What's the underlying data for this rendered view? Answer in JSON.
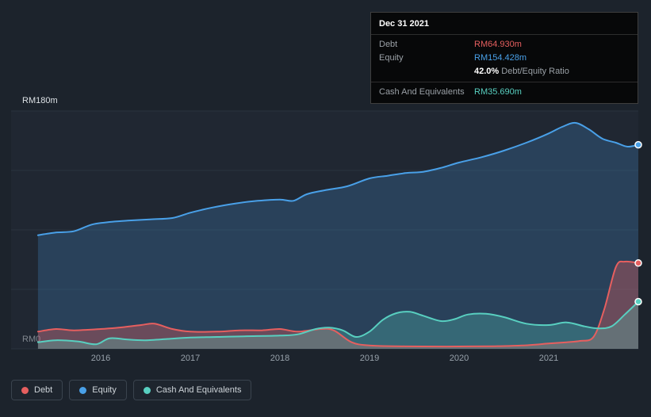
{
  "tooltip": {
    "date": "Dec 31 2021",
    "debt_label": "Debt",
    "debt_value": "RM64.930m",
    "equity_label": "Equity",
    "equity_value": "RM154.428m",
    "ratio_value": "42.0%",
    "ratio_label": "Debt/Equity Ratio",
    "cash_label": "Cash And Equivalents",
    "cash_value": "RM35.690m"
  },
  "axis": {
    "y_top": "RM180m",
    "y_bottom": "RM0",
    "x_ticks": [
      "2016",
      "2017",
      "2018",
      "2019",
      "2020",
      "2021"
    ]
  },
  "legend": {
    "items": [
      {
        "label": "Debt",
        "color": "#e65f5f"
      },
      {
        "label": "Equity",
        "color": "#49a0e8"
      },
      {
        "label": "Cash And Equivalents",
        "color": "#58cfc0"
      }
    ]
  },
  "chart_data": {
    "type": "area",
    "xlim": [
      2015.0,
      2022.0
    ],
    "ylim": [
      0,
      180
    ],
    "y_unit": "RM millions",
    "gridline_values": [
      0,
      45,
      90,
      135,
      180
    ],
    "legend_position": "bottom-left",
    "series": [
      {
        "name": "Equity",
        "color": "#49a0e8",
        "fill_opacity": 0.22,
        "points": [
          [
            2015.3,
            86
          ],
          [
            2015.5,
            88
          ],
          [
            2015.7,
            89
          ],
          [
            2015.9,
            94
          ],
          [
            2016.1,
            96
          ],
          [
            2016.3,
            97
          ],
          [
            2016.55,
            98
          ],
          [
            2016.8,
            99
          ],
          [
            2017,
            103
          ],
          [
            2017.25,
            107
          ],
          [
            2017.5,
            110
          ],
          [
            2017.75,
            112
          ],
          [
            2018,
            113
          ],
          [
            2018.15,
            112
          ],
          [
            2018.3,
            117
          ],
          [
            2018.5,
            120
          ],
          [
            2018.75,
            123
          ],
          [
            2019,
            129
          ],
          [
            2019.2,
            131
          ],
          [
            2019.4,
            133
          ],
          [
            2019.6,
            134
          ],
          [
            2019.8,
            137
          ],
          [
            2020,
            141
          ],
          [
            2020.25,
            145
          ],
          [
            2020.5,
            150
          ],
          [
            2020.75,
            156
          ],
          [
            2021,
            163
          ],
          [
            2021.15,
            168
          ],
          [
            2021.3,
            171
          ],
          [
            2021.45,
            166
          ],
          [
            2021.6,
            159
          ],
          [
            2021.75,
            156
          ],
          [
            2021.88,
            153
          ],
          [
            2022,
            154.428
          ]
        ]
      },
      {
        "name": "Debt",
        "color": "#e65f5f",
        "fill_opacity": 0.35,
        "points": [
          [
            2015.3,
            13
          ],
          [
            2015.5,
            15
          ],
          [
            2015.7,
            14
          ],
          [
            2016,
            15
          ],
          [
            2016.2,
            16
          ],
          [
            2016.45,
            18
          ],
          [
            2016.6,
            19
          ],
          [
            2016.8,
            15
          ],
          [
            2017,
            13
          ],
          [
            2017.3,
            13
          ],
          [
            2017.55,
            14
          ],
          [
            2017.8,
            14
          ],
          [
            2018,
            15
          ],
          [
            2018.2,
            13
          ],
          [
            2018.45,
            15
          ],
          [
            2018.6,
            14
          ],
          [
            2018.8,
            5
          ],
          [
            2019,
            2.5
          ],
          [
            2019.3,
            2
          ],
          [
            2019.6,
            1.8
          ],
          [
            2020,
            1.8
          ],
          [
            2020.4,
            2
          ],
          [
            2020.7,
            2.5
          ],
          [
            2021,
            4
          ],
          [
            2021.2,
            5
          ],
          [
            2021.35,
            6
          ],
          [
            2021.5,
            9
          ],
          [
            2021.62,
            30
          ],
          [
            2021.75,
            62
          ],
          [
            2021.85,
            66
          ],
          [
            2022,
            64.93
          ]
        ]
      },
      {
        "name": "Cash And Equivalents",
        "color": "#58cfc0",
        "fill_opacity": 0.28,
        "points": [
          [
            2015.3,
            5
          ],
          [
            2015.5,
            6.5
          ],
          [
            2015.75,
            5.5
          ],
          [
            2015.95,
            3.5
          ],
          [
            2016.1,
            8
          ],
          [
            2016.3,
            7
          ],
          [
            2016.5,
            6.5
          ],
          [
            2016.75,
            7.5
          ],
          [
            2017,
            8.5
          ],
          [
            2017.3,
            9
          ],
          [
            2017.6,
            9.5
          ],
          [
            2018,
            10
          ],
          [
            2018.2,
            11
          ],
          [
            2018.4,
            15
          ],
          [
            2018.55,
            16
          ],
          [
            2018.7,
            14
          ],
          [
            2018.85,
            9
          ],
          [
            2019,
            13
          ],
          [
            2019.15,
            22
          ],
          [
            2019.3,
            27
          ],
          [
            2019.45,
            28
          ],
          [
            2019.6,
            25
          ],
          [
            2019.8,
            21
          ],
          [
            2019.95,
            22.5
          ],
          [
            2020.1,
            26
          ],
          [
            2020.3,
            26.5
          ],
          [
            2020.5,
            24
          ],
          [
            2020.75,
            19
          ],
          [
            2021,
            18
          ],
          [
            2021.2,
            20
          ],
          [
            2021.4,
            17
          ],
          [
            2021.55,
            15.5
          ],
          [
            2021.7,
            17
          ],
          [
            2021.85,
            26
          ],
          [
            2022,
            35.69
          ]
        ]
      }
    ],
    "end_values": {
      "Debt": 64.93,
      "Equity": 154.428,
      "Cash And Equivalents": 35.69
    }
  }
}
